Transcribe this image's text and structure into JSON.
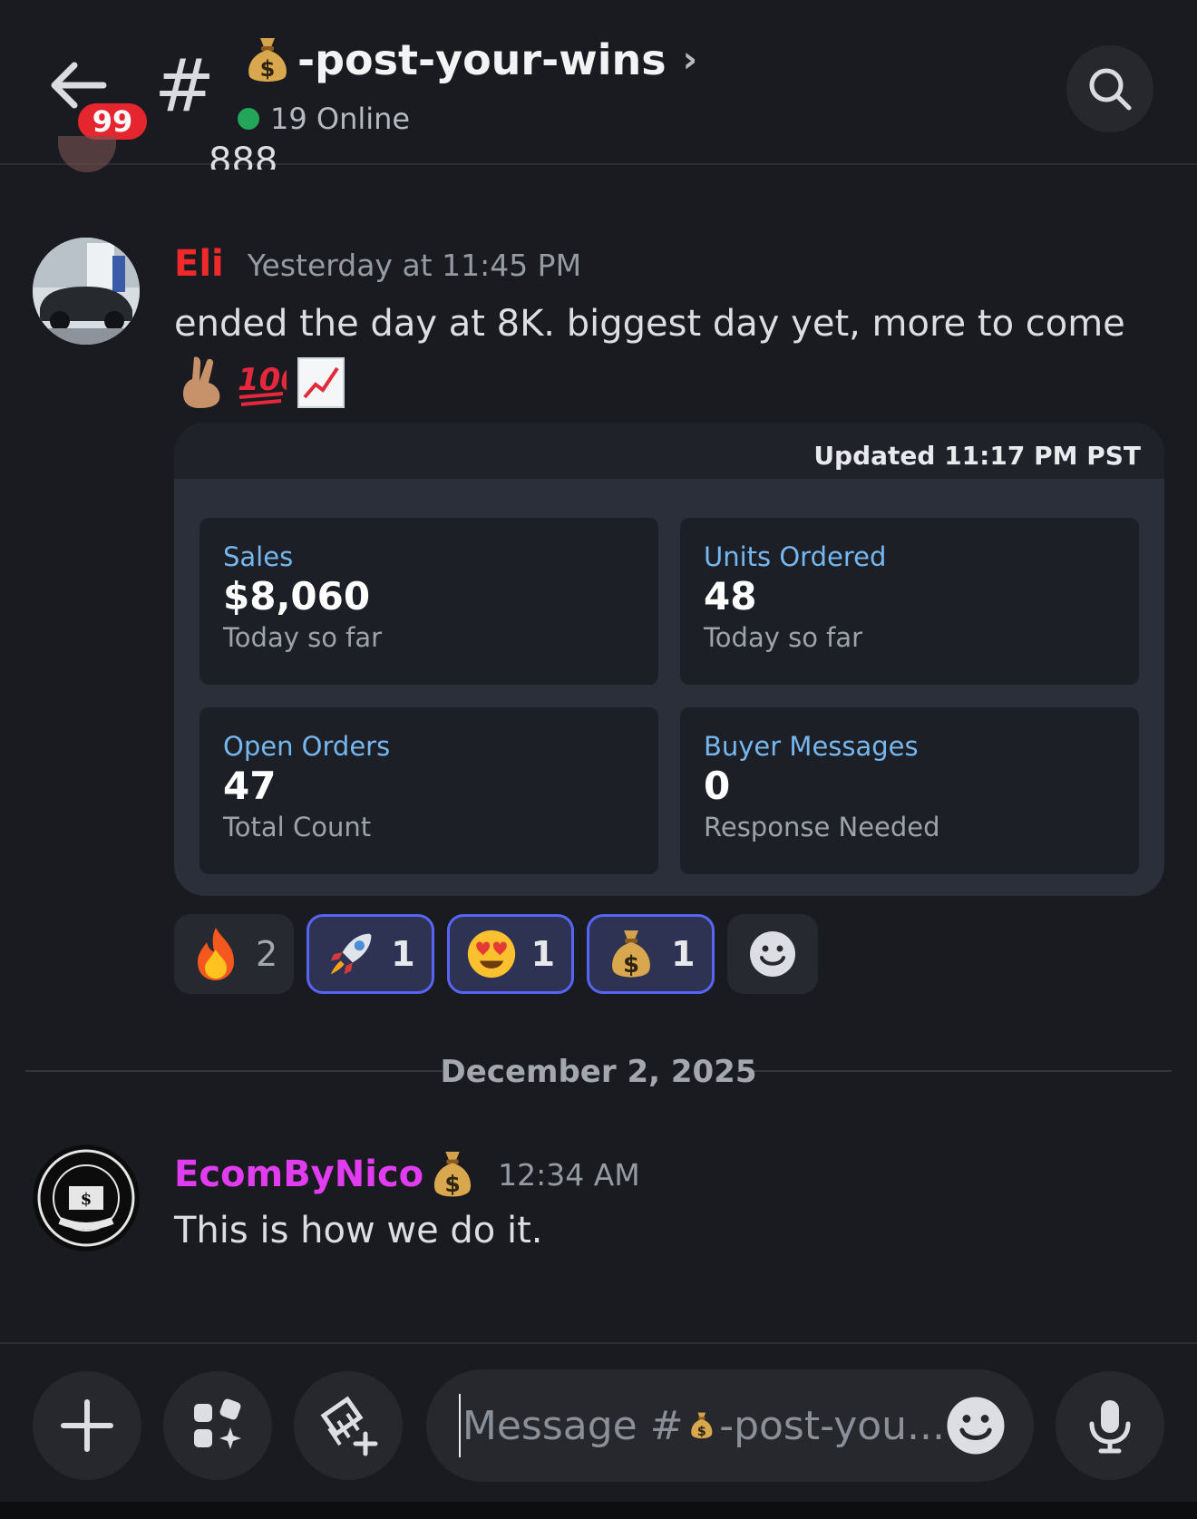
{
  "header": {
    "unread_badge": "99",
    "channel_name": "-post-your-wins",
    "online_text": "19 Online"
  },
  "partial_prev_message": "888",
  "messages": [
    {
      "author": "Eli",
      "author_color": "#ee2a2a",
      "timestamp": "Yesterday at 11:45 PM",
      "text": "ended the day at 8K. biggest day yet, more to come",
      "emoji_line": [
        "crossed-fingers",
        "hundred",
        "chart-increasing"
      ]
    },
    {
      "author": "EcomByNico",
      "author_color": "#e13cf0",
      "timestamp": "12:34 AM",
      "text": "This is how we do it."
    }
  ],
  "stats_card": {
    "updated": "Updated 11:17 PM PST",
    "tiles": [
      {
        "label": "Sales",
        "value": "$8,060",
        "sub": "Today so far"
      },
      {
        "label": "Units Ordered",
        "value": "48",
        "sub": "Today so far"
      },
      {
        "label": "Open Orders",
        "value": "47",
        "sub": "Total Count"
      },
      {
        "label": "Buyer Messages",
        "value": "0",
        "sub": "Response Needed"
      }
    ]
  },
  "reactions": [
    {
      "emoji": "fire",
      "count": "2",
      "active": false
    },
    {
      "emoji": "rocket",
      "count": "1",
      "active": true
    },
    {
      "emoji": "heart-eyes",
      "count": "1",
      "active": true
    },
    {
      "emoji": "money-bag",
      "count": "1",
      "active": true
    }
  ],
  "date_divider": "December 2, 2025",
  "composer": {
    "placeholder_prefix": "Message #",
    "placeholder_suffix": "-post-you..."
  },
  "colors": {
    "background": "#1a1b20",
    "accent": "#5865f2",
    "online": "#23a55a",
    "badge": "#e5262f",
    "tile_label": "#76b7ef"
  }
}
